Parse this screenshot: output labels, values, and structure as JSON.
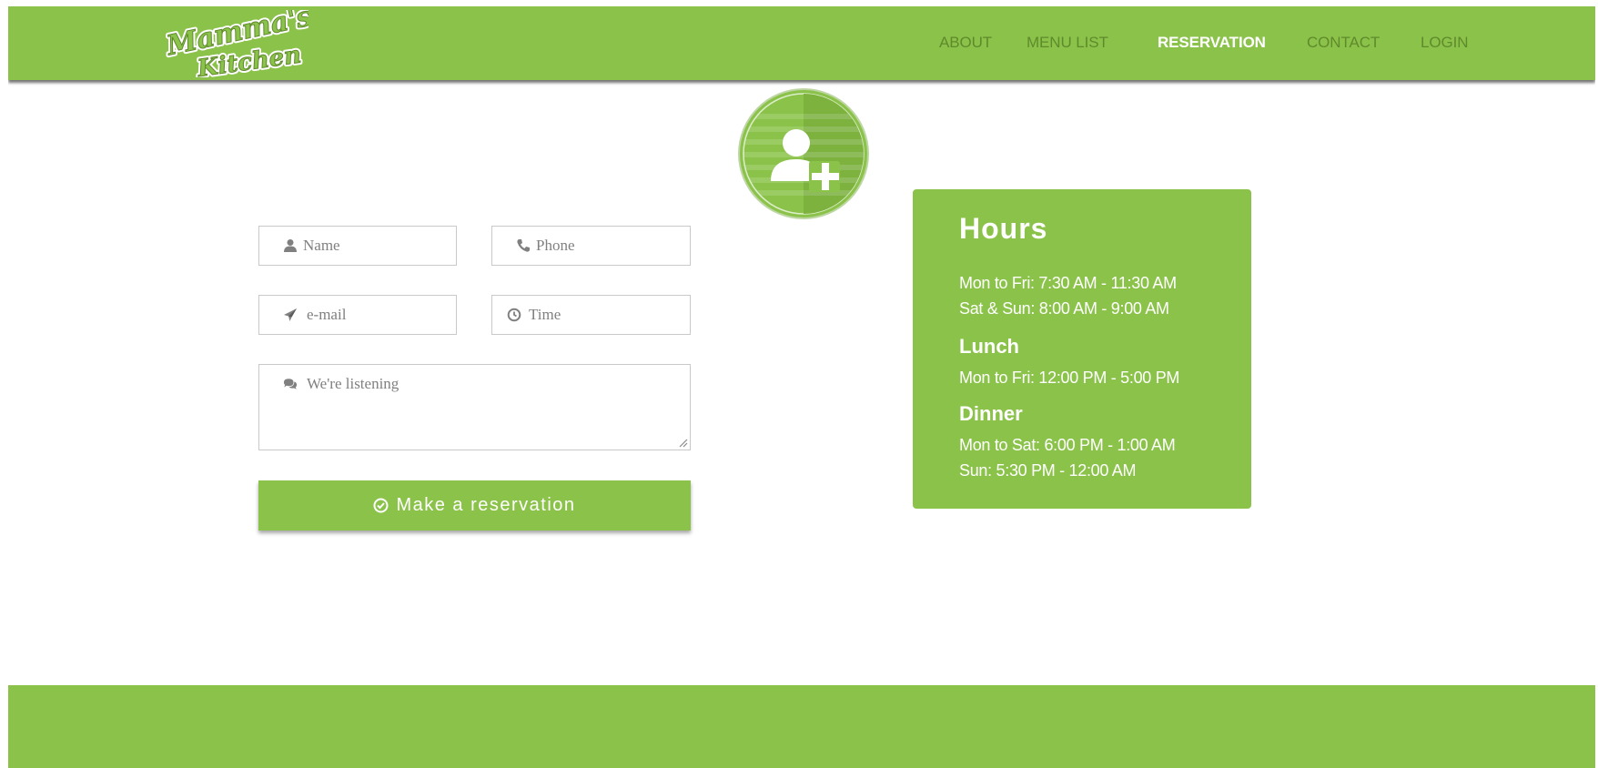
{
  "brand": {
    "logo_text_1": "Mamma's",
    "logo_text_2": "Kitchen"
  },
  "nav": {
    "items": [
      {
        "label": "ABOUT",
        "active": false
      },
      {
        "label": "MENU LIST",
        "active": false
      },
      {
        "label": "RESERVATION",
        "active": true
      },
      {
        "label": "CONTACT",
        "active": false
      },
      {
        "label": "LOGIN",
        "active": false
      }
    ]
  },
  "badge": {
    "icon": "add-user-icon"
  },
  "form": {
    "name": {
      "placeholder": "Name",
      "icon": "user-icon"
    },
    "phone": {
      "placeholder": "Phone",
      "icon": "phone-icon"
    },
    "email": {
      "placeholder": "e-mail",
      "icon": "paper-plane-icon"
    },
    "time": {
      "placeholder": "Time",
      "icon": "clock-icon"
    },
    "message": {
      "placeholder": "We're listening",
      "icon": "comments-icon"
    },
    "submit_label": "Make a reservation",
    "submit_icon": "check-circle-icon"
  },
  "hours": {
    "title": "Hours",
    "breakfast": [
      "Mon to Fri: 7:30 AM - 11:30 AM",
      "Sat & Sun: 8:00 AM - 9:00 AM"
    ],
    "lunch_title": "Lunch",
    "lunch": [
      "Mon to Fri: 12:00 PM - 5:00 PM"
    ],
    "dinner_title": "Dinner",
    "dinner": [
      "Mon to Sat: 6:00 PM - 1:00 AM",
      "Sun: 5:30 PM - 12:00 AM"
    ]
  },
  "colors": {
    "accent": "#8bc34a",
    "nav_text": "#5f8a2c",
    "nav_active": "#ffffff",
    "placeholder": "#808080"
  }
}
